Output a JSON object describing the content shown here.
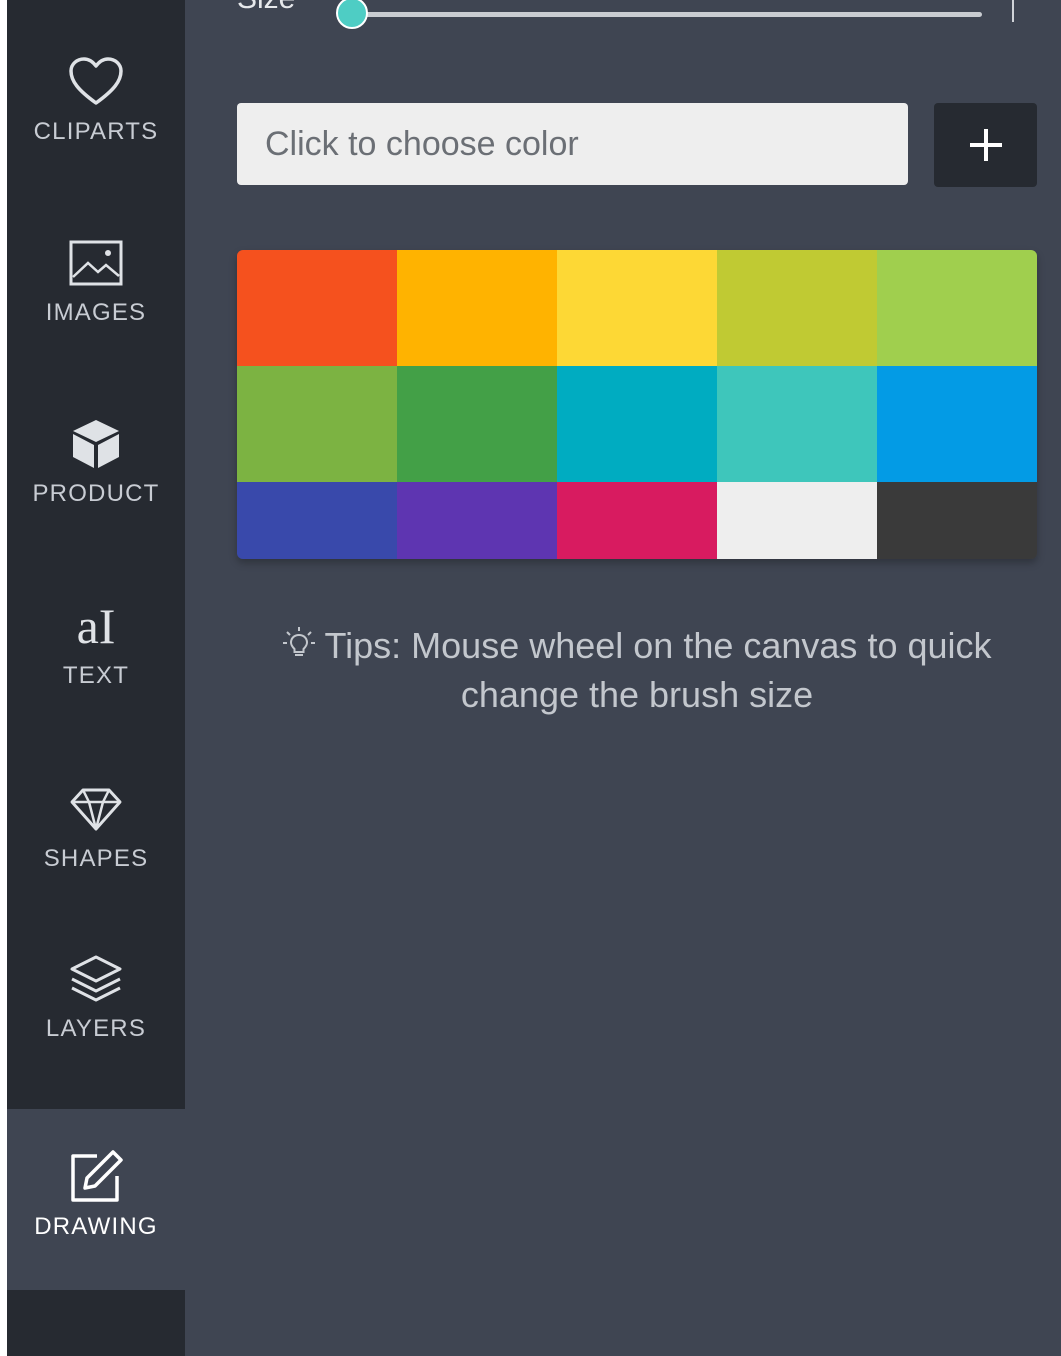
{
  "sidebar": {
    "items": [
      {
        "label": "CLIPARTS",
        "icon": "heart-icon"
      },
      {
        "label": "IMAGES",
        "icon": "image-icon"
      },
      {
        "label": "PRODUCT",
        "icon": "cube-icon"
      },
      {
        "label": "TEXT",
        "icon": "text-icon",
        "glyph": "aI"
      },
      {
        "label": "SHAPES",
        "icon": "diamond-icon"
      },
      {
        "label": "LAYERS",
        "icon": "layers-icon"
      },
      {
        "label": "DRAWING",
        "icon": "edit-icon",
        "active": true
      }
    ]
  },
  "brush": {
    "size_label": "Size",
    "size_value": 0.0
  },
  "color_picker": {
    "placeholder": "Click to choose color",
    "add_label": "+"
  },
  "palette": [
    "#f5511e",
    "#ffb300",
    "#fdd835",
    "#c0ca33",
    "#a0cf4e",
    "#7cb342",
    "#43a047",
    "#00acc1",
    "#3ec6bb",
    "#039be5",
    "#3949ab",
    "#5e35b1",
    "#d81b60",
    "#eeeeee",
    "#3a3a3a"
  ],
  "tips": {
    "icon": "lightbulb-icon",
    "text": "Tips: Mouse wheel on the canvas to quick change the brush size"
  },
  "colors": {
    "sidebar_bg": "#262a31",
    "panel_bg": "#3f4552",
    "accent": "#4ecdc4"
  }
}
